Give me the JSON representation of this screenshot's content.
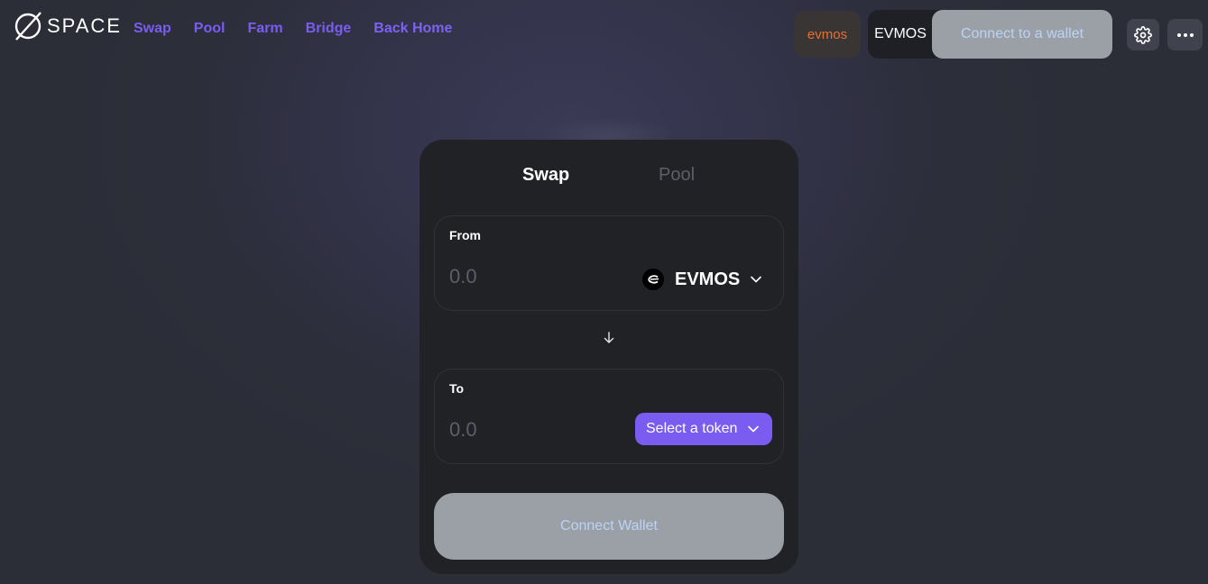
{
  "header": {
    "logo_text": "SPACE",
    "nav": [
      {
        "label": "Swap"
      },
      {
        "label": "Pool"
      },
      {
        "label": "Farm"
      },
      {
        "label": "Bridge"
      },
      {
        "label": "Back Home"
      }
    ],
    "network_chip": "evmos",
    "account_token": "EVMOS",
    "connect_label": "Connect to a wallet",
    "icons": {
      "settings": "gear-icon",
      "more": "more-horizontal-icon"
    }
  },
  "swap_card": {
    "tabs": [
      {
        "label": "Swap",
        "active": true
      },
      {
        "label": "Pool",
        "active": false
      }
    ],
    "from": {
      "label": "From",
      "amount_placeholder": "0.0",
      "token": "EVMOS",
      "token_icon": "evmos-logo-icon"
    },
    "to": {
      "label": "To",
      "amount_placeholder": "0.0",
      "select_label": "Select a token"
    },
    "switch_icon": "arrow-down-icon",
    "connect_label": "Connect Wallet"
  },
  "colors": {
    "accent": "#7a5cf0",
    "network_chip_text": "#e8702e",
    "disabled_button": "#9aa0a6",
    "card_bg": "#212226"
  }
}
